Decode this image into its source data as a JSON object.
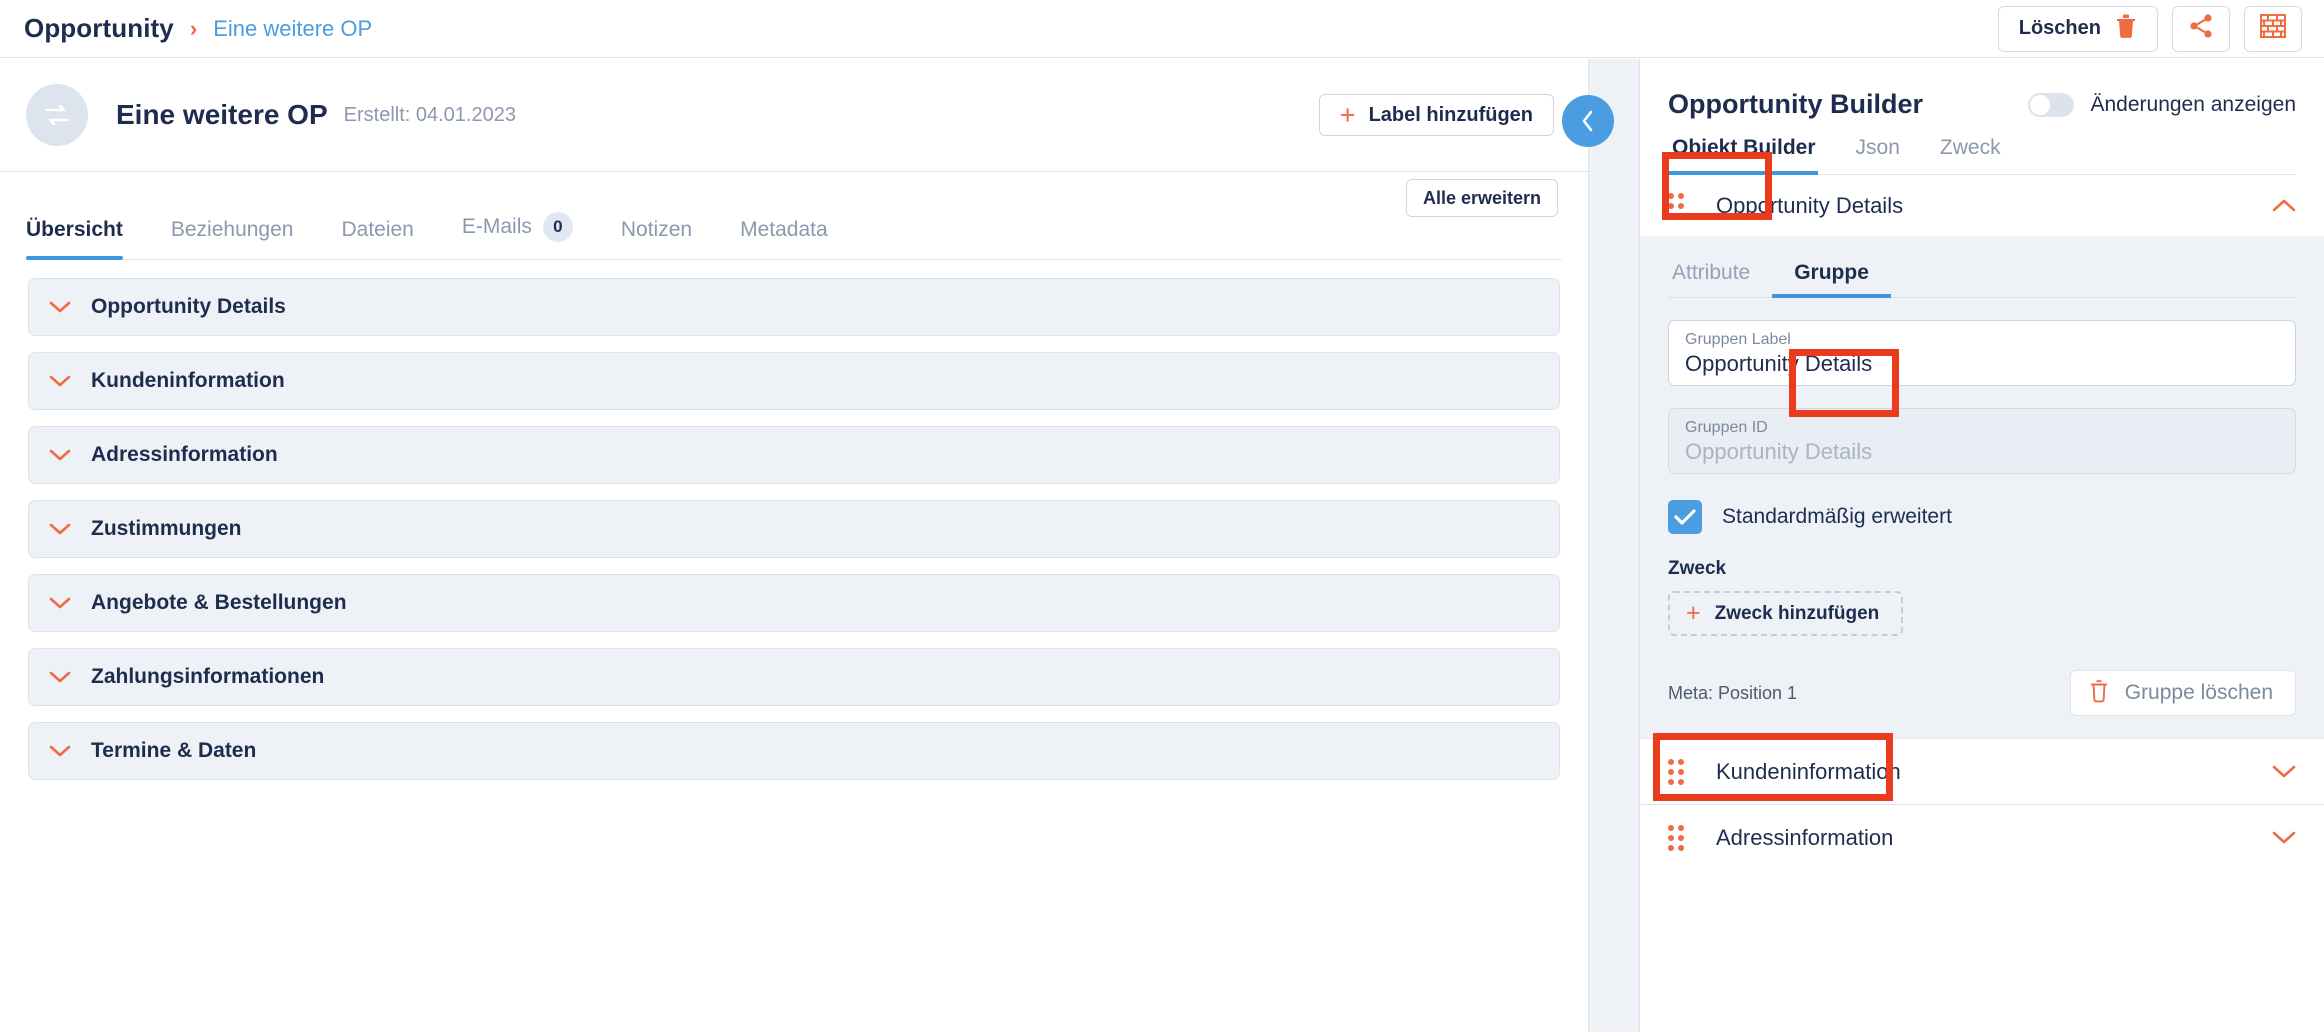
{
  "topbar": {
    "breadcrumb_root": "Opportunity",
    "breadcrumb_separator": "›",
    "breadcrumb_current": "Eine weitere OP",
    "delete_label": "Löschen",
    "icons": {
      "trash": "trash-icon",
      "share": "share-icon",
      "brick": "brick-wall-icon"
    }
  },
  "record": {
    "title": "Eine weitere OP",
    "created": "Erstellt: 04.01.2023",
    "add_label_button": "Label hinzufügen",
    "collapse_glyph": "‹"
  },
  "main": {
    "expand_all": "Alle erweitern",
    "tabs": [
      {
        "label": "Übersicht",
        "active": true,
        "badge": null
      },
      {
        "label": "Beziehungen",
        "active": false,
        "badge": null
      },
      {
        "label": "Dateien",
        "active": false,
        "badge": null
      },
      {
        "label": "E-Mails",
        "active": false,
        "badge": "0"
      },
      {
        "label": "Notizen",
        "active": false,
        "badge": null
      },
      {
        "label": "Metadata",
        "active": false,
        "badge": null
      }
    ],
    "sections": [
      {
        "label": "Opportunity Details"
      },
      {
        "label": "Kundeninformation"
      },
      {
        "label": "Adressinformation"
      },
      {
        "label": "Zustimmungen"
      },
      {
        "label": "Angebote & Bestellungen"
      },
      {
        "label": "Zahlungsinformationen"
      },
      {
        "label": "Termine & Daten"
      }
    ]
  },
  "builder": {
    "title": "Opportunity Builder",
    "toggle_label": "Änderungen anzeigen",
    "toggle_on": false,
    "tabs": [
      {
        "label": "Objekt Builder",
        "active": true
      },
      {
        "label": "Json",
        "active": false
      },
      {
        "label": "Zweck",
        "active": false
      }
    ],
    "group": {
      "header_title": "Opportunity Details",
      "expanded": true,
      "sub_tabs": [
        {
          "label": "Attribute",
          "active": false
        },
        {
          "label": "Gruppe",
          "active": true
        }
      ],
      "fields": [
        {
          "label": "Gruppen Label",
          "value": "Opportunity Details",
          "readonly": false
        },
        {
          "label": "Gruppen ID",
          "value": "Opportunity Details",
          "readonly": true
        }
      ],
      "checkbox": {
        "label": "Standardmäßig erweitert",
        "checked": true
      },
      "zweck_heading": "Zweck",
      "zweck_add_button": "Zweck hinzufügen",
      "meta": "Meta: Position 1",
      "delete_group_button": "Gruppe löschen"
    },
    "other_groups": [
      {
        "label": "Kundeninformation"
      },
      {
        "label": "Adressinformation"
      }
    ]
  },
  "colors": {
    "accent_orange": "#ef6b41",
    "accent_blue": "#4a9de0",
    "annotation_red": "#ea3c1c",
    "text_dark": "#1e2d4f",
    "text_muted": "#8c98ad",
    "panel_bg": "#eef1f6"
  }
}
